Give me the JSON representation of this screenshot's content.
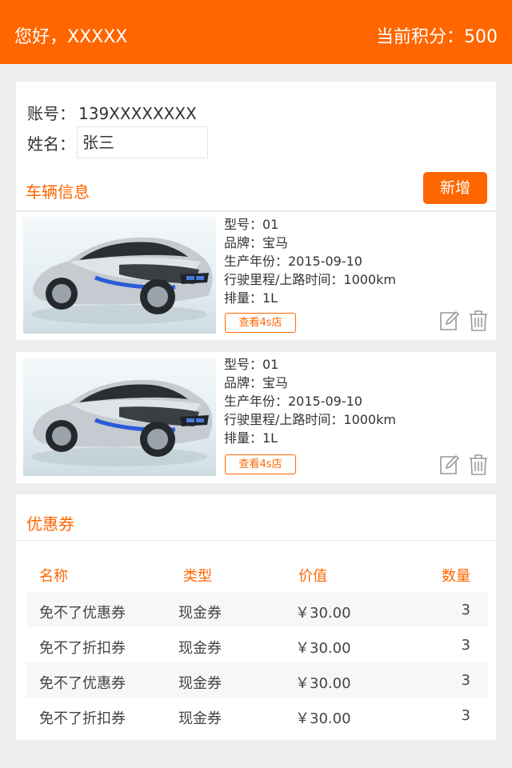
{
  "header": {
    "greeting": "您好，XXXXX",
    "points": "当前积分：500"
  },
  "account": {
    "account_label": "账号：",
    "account_value": "139XXXXXXXX",
    "name_label": "姓名：",
    "name_value": "张三"
  },
  "vehicles": {
    "title": "车辆信息",
    "add_label": "新增",
    "items": [
      {
        "model": "型号：01",
        "brand": "品牌：宝马",
        "year": "生产年份：2015-09-10",
        "mileage": "行驶里程/上路时间：1000km",
        "displacement": "排量：1L",
        "shop_label": "查看4s店"
      },
      {
        "model": "型号：01",
        "brand": "品牌：宝马",
        "year": "生产年份：2015-09-10",
        "mileage": "行驶里程/上路时间：1000km",
        "displacement": "排量：1L",
        "shop_label": "查看4s店"
      }
    ]
  },
  "coupons": {
    "title": "优惠券",
    "columns": [
      "名称",
      "类型",
      "价值",
      "数量"
    ],
    "rows": [
      [
        "免不了优惠券",
        "现金券",
        "￥30.00",
        "3"
      ],
      [
        "免不了折扣券",
        "现金券",
        "￥30.00",
        "3"
      ],
      [
        "免不了优惠券",
        "现金券",
        "￥30.00",
        "3"
      ],
      [
        "免不了折扣券",
        "现金券",
        "￥30.00",
        "3"
      ]
    ]
  },
  "colors": {
    "accent": "#ff6600",
    "background": "#eeeeee",
    "card": "#ffffff"
  },
  "icons": [
    "car-photo",
    "edit-icon",
    "trash-icon"
  ]
}
